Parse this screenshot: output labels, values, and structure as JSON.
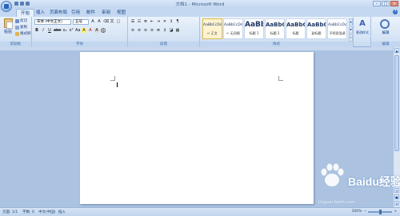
{
  "app": {
    "title": "文档1 - Microsoft Word"
  },
  "tabs": [
    "开始",
    "插入",
    "页面布局",
    "引用",
    "邮件",
    "审阅",
    "视图"
  ],
  "clipboard": {
    "paste": "粘贴",
    "cut": "剪切",
    "copy": "复制",
    "format_painter": "格式刷",
    "group": "剪贴板"
  },
  "font": {
    "name": "宋体 (中文正文)",
    "size": "五号",
    "group": "字体",
    "buttons": [
      "B",
      "I",
      "U",
      "abe",
      "x₂",
      "x²",
      "Aa",
      "A",
      "A",
      "A",
      "A"
    ]
  },
  "paragraph": {
    "group": "段落"
  },
  "styles": {
    "group": "样式",
    "items": [
      {
        "preview": "AaBbCcDd",
        "name": "↵ 正文",
        "selected": true
      },
      {
        "preview": "AaBbCcDd",
        "name": "↵ 无间隔",
        "selected": false
      },
      {
        "preview": "AaBb",
        "name": "标题 1",
        "selected": false
      },
      {
        "preview": "AaBbC",
        "name": "标题 2",
        "selected": false
      },
      {
        "preview": "AaBbC",
        "name": "标题",
        "selected": false
      },
      {
        "preview": "AaBbC",
        "name": "副标题",
        "selected": false
      },
      {
        "preview": "AaBbCcDd",
        "name": "不明显强调",
        "selected": false
      }
    ],
    "change_styles": "更改样式"
  },
  "editing": {
    "group": "编辑",
    "label": "编辑"
  },
  "status": {
    "page": "页面: 1/1",
    "words": "字数: 0",
    "language": "中文(中国)",
    "mode": "插入",
    "zoom": "100%"
  },
  "watermark": {
    "brand": "Baidu经验",
    "url": "jingyan.baidu.com"
  },
  "colors": {
    "ribbon": "#dfeaf8",
    "accent": "#15428b",
    "page": "#ffffff"
  }
}
